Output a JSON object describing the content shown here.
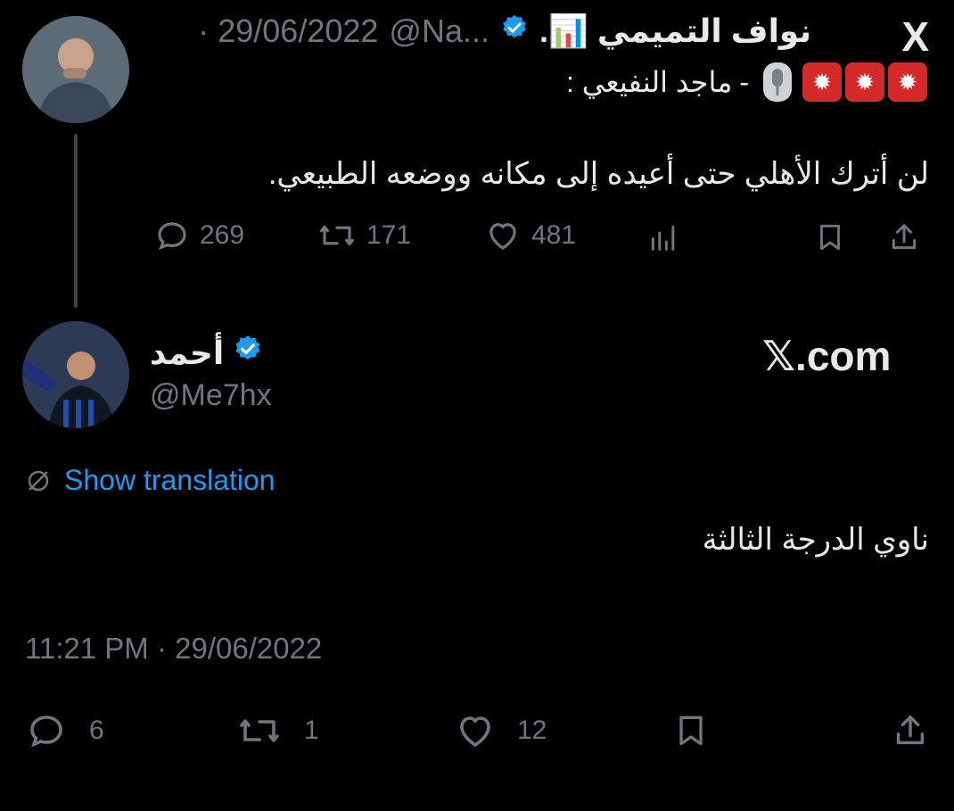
{
  "quoted_tweet": {
    "display_name": "نواف التميمي 📊.",
    "handle": "@Na...",
    "date": "· 29/06/2022",
    "line1_text": "ماجد النفيعي :",
    "line1_separator": "-",
    "body": "لن أترك الأهلي حتى أعيده إلى مكانه ووضعه الطبيعي.",
    "stats": {
      "replies": "269",
      "retweets": "171",
      "likes": "481"
    },
    "logo": "X"
  },
  "reply_tweet": {
    "display_name": "أحمد",
    "handle": "@Me7hx",
    "watermark": "𝕏.com",
    "show_translation": "Show translation",
    "body": "ناوي الدرجة الثالثة",
    "timestamp": "11:21 PM · 29/06/2022",
    "stats": {
      "replies": "6",
      "retweets": "1",
      "likes": "12"
    }
  },
  "colors": {
    "background": "#000000",
    "text": "#e7e9ea",
    "muted": "#71767b",
    "link": "#1d9bf0",
    "verified": "#1d9bf0"
  },
  "icons": {
    "reply": "speech-bubble-icon",
    "retweet": "retweet-icon",
    "like": "heart-icon",
    "views": "bar-chart-icon",
    "bookmark": "bookmark-icon",
    "share": "share-icon",
    "translate": "globe-slash-icon",
    "siren": "siren-emoji-icon",
    "microphone": "microphone-emoji-icon"
  }
}
